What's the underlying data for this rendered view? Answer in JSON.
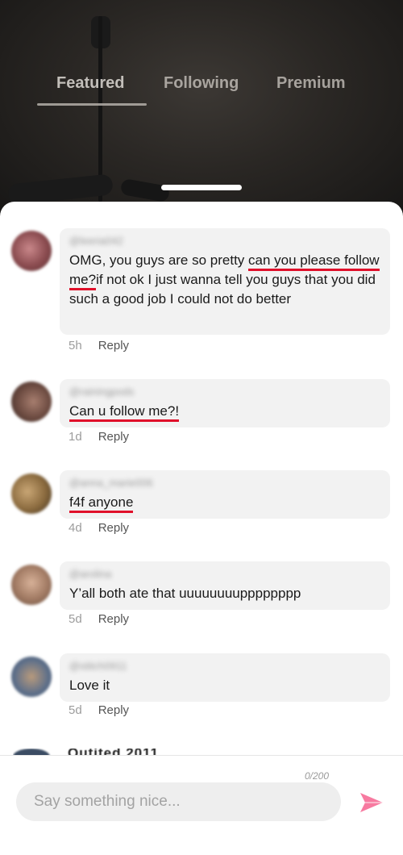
{
  "tabs": [
    {
      "label": "Featured",
      "active": true
    },
    {
      "label": "Following",
      "active": false
    },
    {
      "label": "Premium",
      "active": false
    }
  ],
  "comments": [
    {
      "username": "@leeria042",
      "text_parts": [
        {
          "t": "OMG, you guys are so pretty ",
          "hl": false
        },
        {
          "t": "can you please follow me?",
          "hl": true
        },
        {
          "t": "if not ok I just wanna tell you guys that you did such a good job I could not do better",
          "hl": false
        }
      ],
      "time": "5h",
      "reply": "Reply"
    },
    {
      "username": "@rainingpods",
      "text_parts": [
        {
          "t": "Can u follow me?!",
          "hl": true
        }
      ],
      "time": "1d",
      "reply": "Reply"
    },
    {
      "username": "@anna_marie006",
      "text_parts": [
        {
          "t": "f4f anyone",
          "hl": true
        }
      ],
      "time": "4d",
      "reply": "Reply"
    },
    {
      "username": "@arolina",
      "text_parts": [
        {
          "t": "Y’all both ate that uuuuuuuupppppppp",
          "hl": false
        }
      ],
      "time": "5d",
      "reply": "Reply"
    },
    {
      "username": "@stitch0911",
      "text_parts": [
        {
          "t": "Love it",
          "hl": false
        }
      ],
      "time": "5d",
      "reply": "Reply"
    }
  ],
  "footer": {
    "counter": "0/200",
    "placeholder": "Say something nice...",
    "send_icon": "send-icon",
    "accent": "#f77aa0"
  },
  "peek_username": "Qutited 2011"
}
